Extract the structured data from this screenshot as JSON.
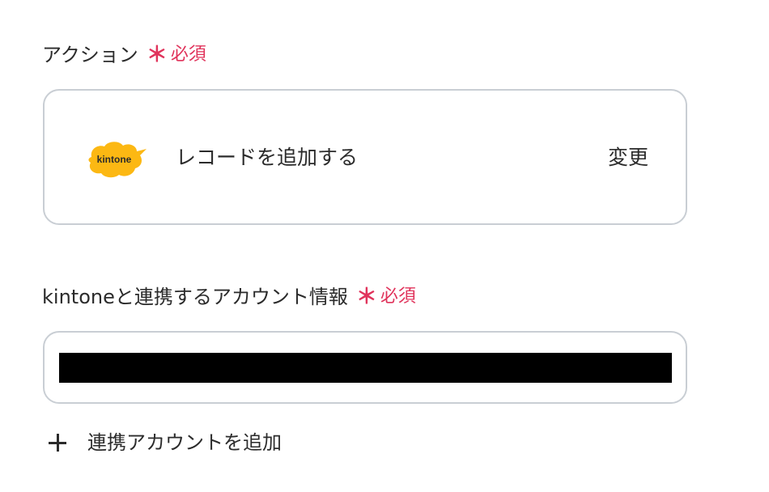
{
  "action_section": {
    "label": "アクション",
    "required_mark": "＊",
    "required_text": "必須",
    "app_logo_text": "kintone",
    "action_name": "レコードを追加する",
    "change_label": "変更"
  },
  "account_section": {
    "label": "kintoneと連携するアカウント情報",
    "required_mark": "＊",
    "required_text": "必須",
    "add_account_label": "連携アカウントを追加"
  },
  "colors": {
    "required": "#e0335b",
    "kintone_yellow": "#fcb813",
    "border": "#c9ced4"
  },
  "icons": {
    "add": "plus-icon",
    "app": "kintone-logo"
  }
}
